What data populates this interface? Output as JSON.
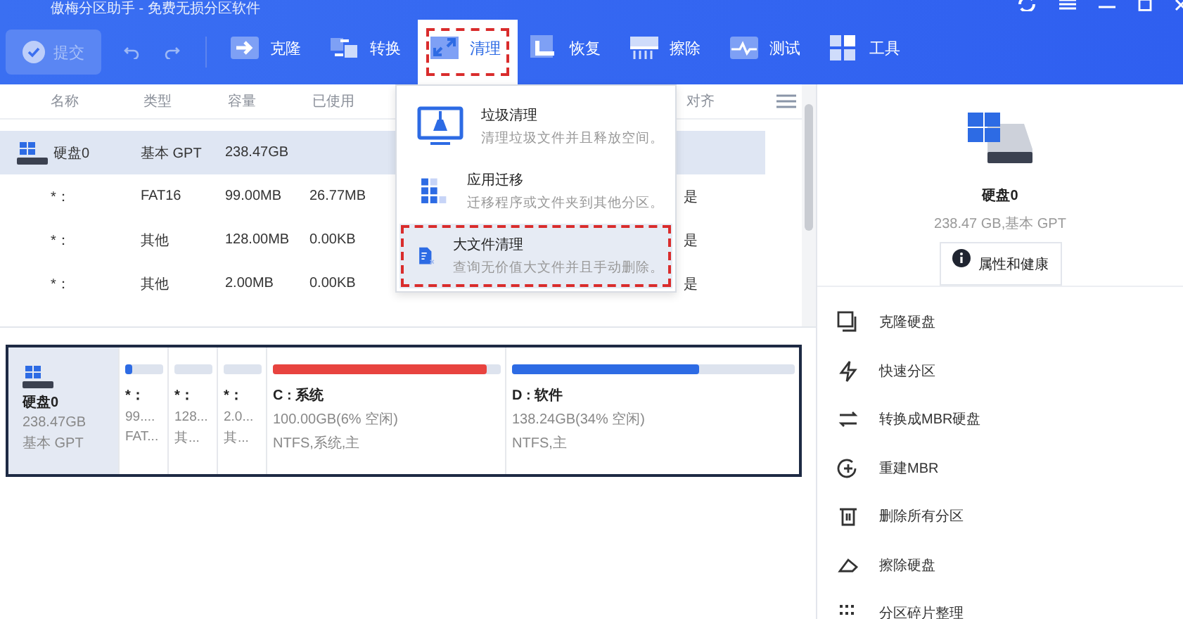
{
  "window": {
    "title": "傲梅分区助手 - 免费无损分区软件"
  },
  "toolbar": {
    "commit": {
      "label": "提交",
      "disabled": true
    },
    "items": [
      {
        "label": "克隆",
        "selected": false
      },
      {
        "label": "转换",
        "selected": false
      },
      {
        "label": "清理",
        "selected": true
      },
      {
        "label": "恢复",
        "selected": false
      },
      {
        "label": "擦除",
        "selected": false
      },
      {
        "label": "测试",
        "selected": false
      },
      {
        "label": "工具",
        "selected": false
      }
    ]
  },
  "table": {
    "columns": [
      "名称",
      "类型",
      "容量",
      "已使用",
      "对齐"
    ],
    "rows": [
      {
        "name": "硬盘0",
        "type": "基本 GPT",
        "capacity": "238.47GB",
        "selected": true,
        "children": [
          {
            "name": "*：",
            "type": "FAT16",
            "capacity": "99.00MB",
            "used": "26.77MB",
            "align": "是"
          },
          {
            "name": "*：",
            "type": "其他",
            "capacity": "128.00MB",
            "used": "0.00KB",
            "align": "是"
          },
          {
            "name": "*：",
            "type": "其他",
            "capacity": "2.00MB",
            "used": "0.00KB",
            "align": "是"
          }
        ]
      }
    ]
  },
  "clean_menu": {
    "items": [
      {
        "title": "垃圾清理",
        "description": "清理垃圾文件并且释放空间。",
        "selected": false
      },
      {
        "title": "应用迁移",
        "description": "迁移程序或文件夹到其他分区。",
        "selected": false
      },
      {
        "title": "大文件清理",
        "description": "查询无价值大文件并且手动删除。",
        "selected": true
      }
    ]
  },
  "disk_map": {
    "disk": {
      "name": "硬盘0",
      "size": "238.47GB",
      "style": "基本 GPT",
      "selected": true
    },
    "partitions": [
      {
        "name": "*：",
        "size": "99....",
        "detail": "FAT...",
        "level": 0.2,
        "color": "#2d6be4"
      },
      {
        "name": "*：",
        "size": "128...",
        "detail": "其..."
      },
      {
        "name": "*：",
        "size": "2.0...",
        "detail": "其..."
      },
      {
        "name": "C : 系统",
        "size": "100.00GB(6% 空闲)",
        "detail": "NTFS,系统,主",
        "level": 0.94,
        "color": "#e8433f"
      },
      {
        "name": "D : 软件",
        "size": "138.24GB(34% 空闲)",
        "detail": "NTFS,主",
        "level": 0.66,
        "color": "#2d6be4"
      }
    ]
  },
  "details": {
    "title": "硬盘0",
    "subtitle": "238.47 GB,基本 GPT",
    "button": "属性和健康",
    "actions": [
      "克隆硬盘",
      "快速分区",
      "转换成MBR硬盘",
      "重建MBR",
      "删除所有分区",
      "擦除硬盘",
      "分区碎片整理"
    ]
  }
}
